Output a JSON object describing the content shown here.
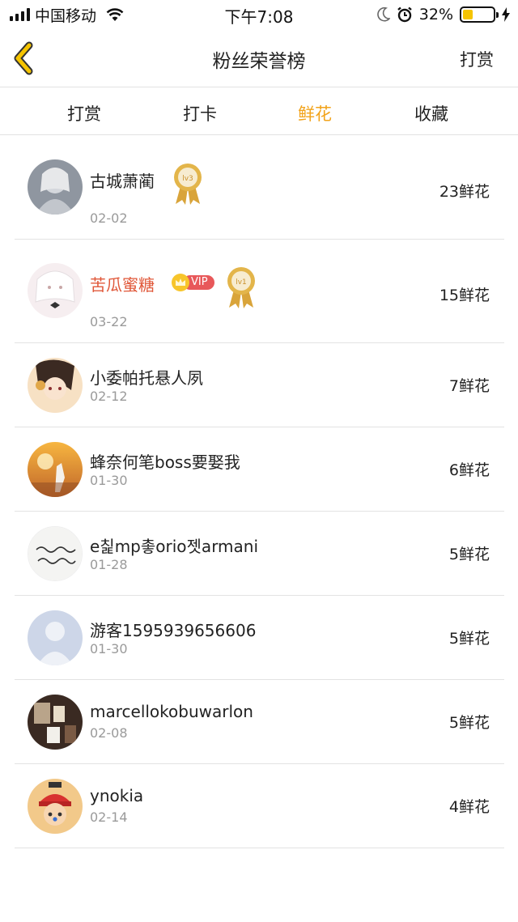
{
  "status_bar": {
    "carrier": "中国移动",
    "time": "下午7:08",
    "battery_pct": "32%",
    "battery_level": 0.32,
    "icons": [
      "signal-icon",
      "wifi-icon",
      "moon-icon",
      "alarm-icon",
      "battery-icon",
      "charging-icon"
    ]
  },
  "nav": {
    "title": "粉丝荣誉榜",
    "action_label": "打赏",
    "back_icon": "chevron-left-icon"
  },
  "tabs": [
    {
      "label": "打赏",
      "active": false
    },
    {
      "label": "打卡",
      "active": false
    },
    {
      "label": "鲜花",
      "active": true
    },
    {
      "label": "收藏",
      "active": false
    }
  ],
  "colors": {
    "accent": "#f2a31b",
    "vip_name": "#e0583a",
    "vip_badge": "#e8585a",
    "medal_gold": "#e3b54a",
    "divider": "#e3e3e3",
    "date_text": "#9a9a9a"
  },
  "rows": [
    {
      "name": "古城萧蔺",
      "date": "02-02",
      "count": "23鲜花",
      "vip": false,
      "medal": "lv3"
    },
    {
      "name": "苦瓜蜜糖",
      "date": "03-22",
      "count": "15鲜花",
      "vip": true,
      "vip_label": "VIP",
      "medal": "lv1"
    },
    {
      "name": "小委帕托悬人夙",
      "date": "02-12",
      "count": "7鲜花",
      "vip": false,
      "medal": ""
    },
    {
      "name": "蜂奈何笔boss要娶我",
      "date": "01-30",
      "count": "6鲜花",
      "vip": false,
      "medal": ""
    },
    {
      "name": "e칥mp촣orio젯armani",
      "date": "01-28",
      "count": "5鲜花",
      "vip": false,
      "medal": ""
    },
    {
      "name": "游客1595939656606",
      "date": "01-30",
      "count": "5鲜花",
      "vip": false,
      "medal": ""
    },
    {
      "name": "marcellokobuwarlon",
      "date": "02-08",
      "count": "5鲜花",
      "vip": false,
      "medal": ""
    },
    {
      "name": "ynokia",
      "date": "02-14",
      "count": "4鲜花",
      "vip": false,
      "medal": ""
    }
  ]
}
